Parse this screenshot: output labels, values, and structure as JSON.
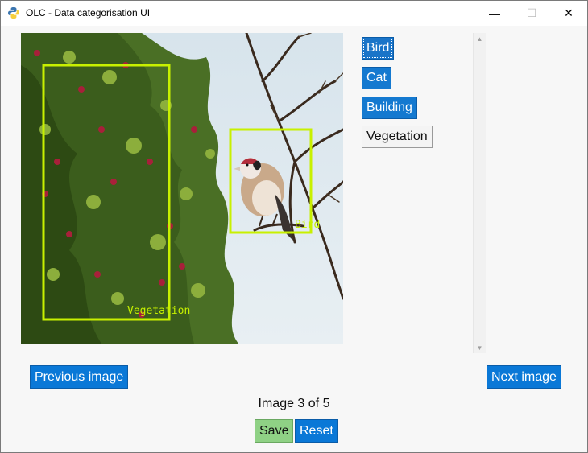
{
  "window": {
    "title": "OLC - Data categorisation UI",
    "minimize": "—",
    "maximize": "☐",
    "close": "✕"
  },
  "image": {
    "description_icon": "photo-bird-on-branch",
    "annotations": [
      {
        "label": "Vegetation",
        "color": "#c8f000"
      },
      {
        "label": "Bird",
        "color": "#c8f000"
      }
    ]
  },
  "categories": [
    {
      "label": "Bird",
      "selected": true
    },
    {
      "label": "Cat",
      "selected": false
    },
    {
      "label": "Building",
      "selected": false
    },
    {
      "label": "Vegetation",
      "selected": false
    }
  ],
  "scrollbar": {
    "up": "▲",
    "down": "▼"
  },
  "navigation": {
    "previous": "Previous image",
    "next": "Next image",
    "counter": "Image 3 of 5"
  },
  "actions": {
    "save": "Save",
    "reset": "Reset"
  },
  "colors": {
    "accent": "#0a78d7",
    "save": "#8fd185",
    "bbox": "#c8f000"
  }
}
